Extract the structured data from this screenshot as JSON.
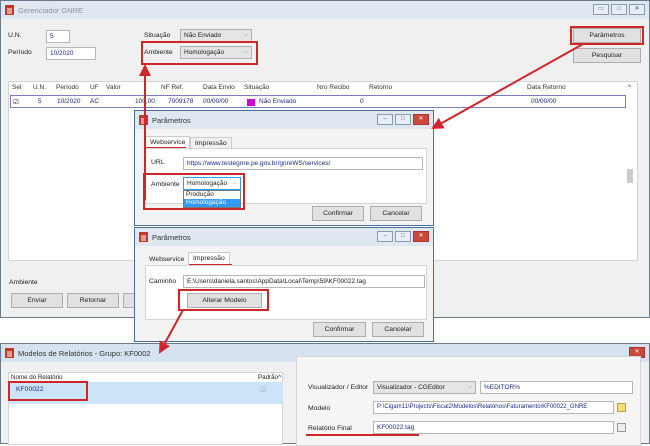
{
  "main": {
    "title": "Gerenciador GNRE",
    "un_label": "U.N.",
    "un_value": "5",
    "periodo_label": "Período",
    "periodo_value": "10/2020",
    "situacao_label": "Situação",
    "situacao_value": "Não Enviado",
    "ambiente_label": "Ambiente",
    "ambiente_value": "Homologação",
    "parametros": "Parâmetros",
    "pesquisar": "Pesquisar",
    "columns": [
      "Sel",
      "U.N.",
      "Período",
      "UF",
      "Valor",
      "NF Ref.",
      "Data Envio",
      "Situação",
      "Nro Recibo",
      "Retorno",
      "Data Retorno"
    ],
    "row": {
      "un": "5",
      "periodo": "10/2020",
      "uf": "AC",
      "valor": "100,00",
      "nf": "7009178",
      "data_envio": "00/00/00",
      "situacao": "Não Enviado",
      "recibo": "0",
      "data_retorno": "00/00/00"
    },
    "footer_ambiente": "Ambiente",
    "enviar": "Enviar",
    "retornar": "Retornar"
  },
  "dlg1": {
    "title": "Parâmetros",
    "tab_web": "Webservice",
    "tab_imp": "Impressão",
    "url_label": "URL",
    "url_value": "https://www.testegnre.pe.gov.br/gnreWS/services/",
    "ambiente_label": "Ambiente",
    "ambiente_value": "Homologação",
    "options": [
      "Produção",
      "Homologação"
    ],
    "confirmar": "Confirmar",
    "cancelar": "Cancelar"
  },
  "dlg2": {
    "title": "Parâmetros",
    "tab_web": "Webservice",
    "tab_imp": "Impressão",
    "caminho_label": "Caminho",
    "caminho_value": "E:\\Users\\daniela.santos\\AppData\\Local\\Temp\\59\\KF00022.tag",
    "alterar": "Alterar Modelo",
    "confirmar": "Confirmar",
    "cancelar": "Cancelar"
  },
  "modelos": {
    "title": "Modelos de Relatórios - Grupo: KF0002",
    "col_nome": "Nome do Relatório",
    "col_padrao": "Padrão",
    "item": "KF00022",
    "vis_label": "Visualizador / Editor",
    "vis_value": "Visualizador - CGEditor",
    "editor_value": "%EDITOR%",
    "modelo_label": "Modelo",
    "modelo_value": "P:\\Cigam11\\Projects\\Fiscal2\\Modelos\\Relatorios\\Faturamento\\KF00022_GNRE",
    "final_label": "Relatório Final",
    "final_value": "KF00022.tag"
  },
  "colors": {
    "highlight": "#d0262b",
    "selection": "#3399ff"
  }
}
